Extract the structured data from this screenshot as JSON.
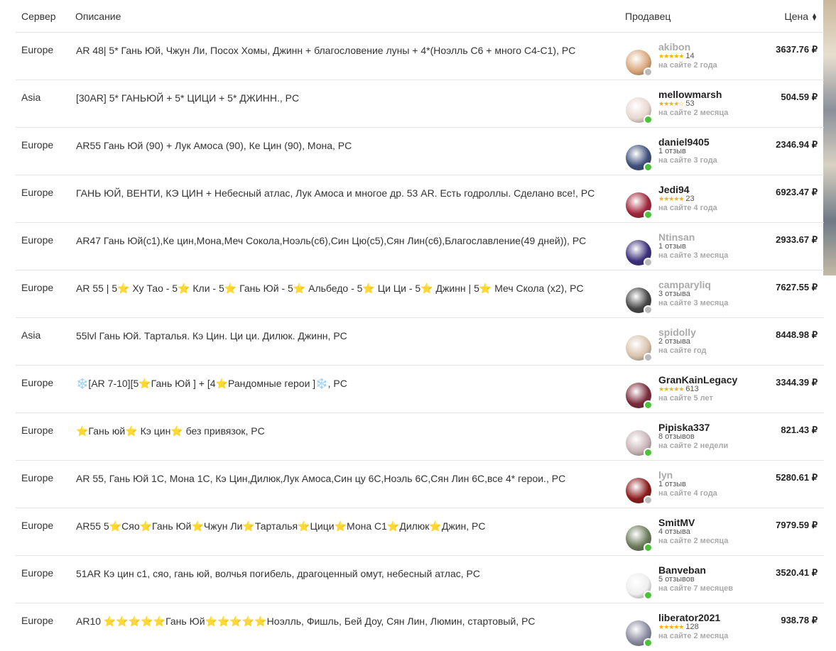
{
  "header": {
    "server": "Сервер",
    "description": "Описание",
    "seller": "Продавец",
    "price": "Цена"
  },
  "colors": {
    "online": "#4cc23a",
    "offline": "#bbbbbb",
    "star": "#f5b400"
  },
  "rows": [
    {
      "server": "Europe",
      "desc": "AR 48| 5* Гань Юй, Чжун Ли, Посох Хомы, Джинн + благословение луны + 4*(Ноэлль С6 + много С4-С1), PC",
      "seller": "akibon",
      "rating": "14",
      "stars": "★★★★★",
      "since": "на сайте 2 года",
      "price": "3637.76 ₽",
      "online": false,
      "avatar_color": "#d9a77a"
    },
    {
      "server": "Asia",
      "desc": "[30AR] 5* ГАНЬЮЙ + 5* ЦИЦИ + 5* ДЖИНН., PC",
      "seller": "mellowmarsh",
      "rating": "53",
      "stars": "★★★★☆",
      "since": "на сайте 2 месяца",
      "price": "504.59 ₽",
      "online": true,
      "avatar_color": "#e9d6d0"
    },
    {
      "server": "Europe",
      "desc": "AR55 Гань Юй (90) + Лук Амоса (90), Ке Цин (90), Мона, PC",
      "seller": "daniel9405",
      "rating": "1 отзыв",
      "stars": "",
      "since": "на сайте 3 года",
      "price": "2346.94 ₽",
      "online": true,
      "avatar_color": "#3d4e7a"
    },
    {
      "server": "Europe",
      "desc": "ГАНЬ ЮЙ, ВЕНТИ, КЭ ЦИН + Небесный атлас, Лук Амоса и многое др. 53 AR. Есть годроллы. Сделано все!, PC",
      "seller": "Jedi94",
      "rating": "23",
      "stars": "★★★★★",
      "since": "на сайте 4 года",
      "price": "6923.47 ₽",
      "online": true,
      "avatar_color": "#a0253a"
    },
    {
      "server": "Europe",
      "desc": "AR47 Гань Юй(с1),Ке цин,Мона,Меч Сокола,Ноэль(с6),Син Цю(с5),Сян Лин(с6),Благославление(49 дней)), PC",
      "seller": "Ntinsan",
      "rating": "1 отзыв",
      "stars": "",
      "since": "на сайте 3 месяца",
      "price": "2933.67 ₽",
      "online": false,
      "avatar_color": "#3a2f7a"
    },
    {
      "server": "Europe",
      "desc": "AR 55 | 5⭐ Ху Тао - 5⭐ Кли - 5⭐ Гань Юй - 5⭐ Альбедо - 5⭐ Ци Ци - 5⭐ Джинн | 5⭐ Меч Скола (x2), PC",
      "seller": "camparyliq",
      "rating": "3 отзыва",
      "stars": "",
      "since": "на сайте 3 месяца",
      "price": "7627.55 ₽",
      "online": false,
      "avatar_color": "#444444"
    },
    {
      "server": "Asia",
      "desc": "55lvl Гань Юй. Тарталья. Кэ Цин. Ци ци. Дилюк. Джинн, PC",
      "seller": "spidolly",
      "rating": "2 отзыва",
      "stars": "",
      "since": "на сайте год",
      "price": "8448.98 ₽",
      "online": false,
      "avatar_color": "#d8c2ad"
    },
    {
      "server": "Europe",
      "desc": "❄️[AR 7-10][5⭐Гань Юй ] + [4⭐Рандомные герои ]❄️, PC",
      "seller": "GranKainLegacy",
      "rating": "613",
      "stars": "★★★★★",
      "since": "на сайте 5 лет",
      "price": "3344.39 ₽",
      "online": true,
      "avatar_color": "#7a2a3a"
    },
    {
      "server": "Europe",
      "desc": "⭐Гань юй⭐ Кэ цин⭐ без привязок, PC",
      "seller": "Pipiska337",
      "rating": "8 отзывов",
      "stars": "",
      "since": "на сайте 2 недели",
      "price": "821.43 ₽",
      "online": true,
      "avatar_color": "#c9b4b8"
    },
    {
      "server": "Europe",
      "desc": "AR 55, Гань Юй 1С, Мона 1С, Кэ Цин,Дилюк,Лук Амоса,Син цу 6С,Ноэль 6С,Сян Лин 6С,все 4* герои., PC",
      "seller": "lyn",
      "rating": "1 отзыв",
      "stars": "",
      "since": "на сайте 4 года",
      "price": "5280.61 ₽",
      "online": false,
      "avatar_color": "#8a1a1a"
    },
    {
      "server": "Europe",
      "desc": "AR55 5⭐Сяо⭐Гань Юй⭐Чжун Ли⭐Тарталья⭐Цици⭐Мона С1⭐Дилюк⭐Джин, PC",
      "seller": "SmitMV",
      "rating": "4 отзыва",
      "stars": "",
      "since": "на сайте 2 месяца",
      "price": "7979.59 ₽",
      "online": true,
      "avatar_color": "#6b7a5a"
    },
    {
      "server": "Europe",
      "desc": "51AR Кэ цин с1, сяо, гань юй, волчья погибель, драгоценный омут, небесный атлас, PC",
      "seller": "Banveban",
      "rating": "5 отзывов",
      "stars": "",
      "since": "на сайте 7 месяцев",
      "price": "3520.41 ₽",
      "online": true,
      "avatar_color": "#eeeeee"
    },
    {
      "server": "Europe",
      "desc": "AR10 ⭐⭐⭐⭐⭐Гань Юй⭐⭐⭐⭐⭐Ноэлль, Фишль, Бей Доу, Сян Лин, Люмин, стартовый, PC",
      "seller": "liberator2021",
      "rating": "128",
      "stars": "★★★★★",
      "since": "на сайте 2 месяца",
      "price": "938.78 ₽",
      "online": true,
      "avatar_color": "#8a8aa0"
    }
  ]
}
